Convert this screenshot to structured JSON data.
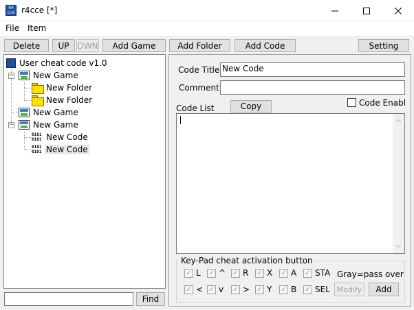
{
  "window": {
    "title": "r4cce [*]",
    "icon_text": "R4 cce"
  },
  "menu": [
    {
      "label": "File"
    },
    {
      "label": "Item"
    }
  ],
  "toolbar": {
    "delete": "Delete",
    "up": "UP",
    "down": "DWN",
    "add_game": "Add Game",
    "add_folder": "Add Folder",
    "add_code": "Add Code",
    "setting": "Setting"
  },
  "tree": {
    "root": "User cheat code v1.0",
    "items": [
      {
        "label": "New Game",
        "type": "game"
      },
      {
        "label": "New Folder",
        "type": "folder"
      },
      {
        "label": "New Folder",
        "type": "folder"
      },
      {
        "label": "New Game",
        "type": "game"
      },
      {
        "label": "New Game",
        "type": "game"
      },
      {
        "label": "New Code",
        "type": "code"
      },
      {
        "label": "New Code",
        "type": "code",
        "selected": true
      }
    ],
    "code_icon_text": "0101 0101"
  },
  "find": {
    "value": "",
    "button": "Find"
  },
  "details": {
    "code_title_label": "Code Title",
    "code_title_value": "New Code",
    "comment_label": "Comment",
    "comment_value": "",
    "code_list_label": "Code List",
    "copy_button": "Copy",
    "code_enable_label": "Code Enable",
    "code_list_value": ""
  },
  "keypad": {
    "title": "Key-Pad cheat activation button",
    "row1": [
      "L",
      "^",
      "R",
      "X",
      "A",
      "STA"
    ],
    "row2": [
      "<",
      "v",
      ">",
      "Y",
      "B",
      "SEL"
    ],
    "gray_note": "Gray=pass over",
    "modify_button": "Modify",
    "add_button": "Add"
  },
  "colors": {
    "selection": "#e8e8e8",
    "border": "#adadad",
    "window_bg": "#f0f0f0"
  }
}
